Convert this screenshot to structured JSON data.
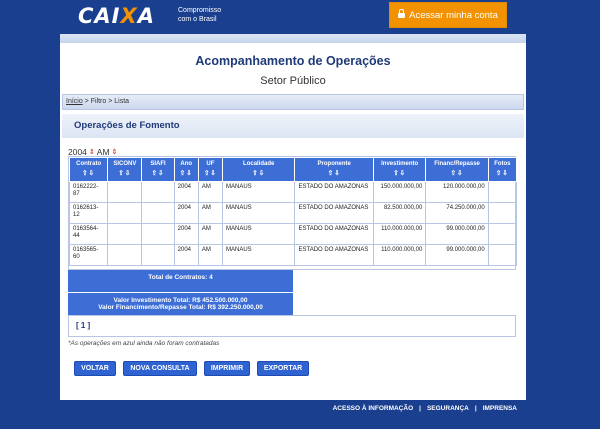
{
  "header": {
    "logo_prefix": "CAI",
    "logo_x": "X",
    "logo_suffix": "A",
    "tagline_line1": "Compromisso",
    "tagline_line2": "com o Brasil",
    "access_button": "Acessar minha conta",
    "icon": "lock-icon"
  },
  "page": {
    "title": "Acompanhamento de Operações",
    "subtitle": "Setor Público",
    "breadcrumb": {
      "home": "Início",
      "sep1": " > ",
      "filter": "Filtro",
      "sep2": " > ",
      "list": "Lista"
    },
    "section": "Operações de Fomento",
    "filter_year": "2004",
    "filter_uf": "AM"
  },
  "table": {
    "columns": [
      "Contrato",
      "SICONV",
      "SIAFI",
      "Ano",
      "UF",
      "Localidade",
      "Proponente",
      "Investimento",
      "Financ/Repasse",
      "Fotos"
    ],
    "rows": [
      [
        "0162222-87",
        "",
        "",
        "2004",
        "AM",
        "MANAUS",
        "ESTADO DO AMAZONAS",
        "150.000.000,00",
        "120.000.000,00",
        ""
      ],
      [
        "0162613-12",
        "",
        "",
        "2004",
        "AM",
        "MANAUS",
        "ESTADO DO AMAZONAS",
        "82.500.000,00",
        "74.250.000,00",
        ""
      ],
      [
        "0163564-44",
        "",
        "",
        "2004",
        "AM",
        "MANAUS",
        "ESTADO DO AMAZONAS",
        "110.000.000,00",
        "99.000.000,00",
        ""
      ],
      [
        "0163565-60",
        "",
        "",
        "2004",
        "AM",
        "MANAUS",
        "ESTADO DO AMAZONAS",
        "110.000.000,00",
        "99.000.000,00",
        ""
      ]
    ]
  },
  "totals": {
    "contracts": "Total de Contratos: 4",
    "investment": "Valor Investimento Total: R$ 452.500.000,00",
    "financing": "Valor Financimento/Repasse Total: R$ 392.250.000,00"
  },
  "pager": "[ 1 ]",
  "note": "*As operações em azul ainda não foram contratadas",
  "buttons": {
    "back": "VOLTAR",
    "new_query": "NOVA CONSULTA",
    "print": "IMPRIMIR",
    "export": "EXPORTAR"
  },
  "footer": {
    "info": "ACESSO À INFORMAÇÃO",
    "security": "SEGURANÇA",
    "press": "IMPRENSA",
    "sep": "|"
  },
  "colors": {
    "brand_blue": "#1a3f8f",
    "accent_orange": "#f39200",
    "table_header": "#3d6ed6"
  }
}
